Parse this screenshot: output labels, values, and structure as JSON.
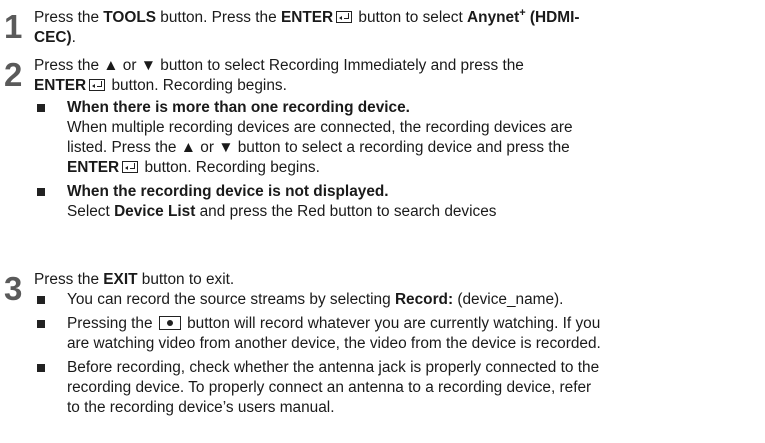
{
  "steps": [
    {
      "number": "1",
      "text": {
        "a": "Press the ",
        "tools": "TOOLS",
        "b": " button. Press the ",
        "enter": "ENTER",
        "c": " button to select ",
        "anynet": "Anynet",
        "plus": "+",
        "hdmi1": " (HDMI-",
        "hdmi2": "CEC)",
        "period": "."
      }
    },
    {
      "number": "2",
      "text": {
        "line1": "Press the ▲ or ▼ button to select Recording Immediately and press the",
        "enter": "ENTER",
        "rest": " button. Recording begins."
      },
      "bullets": [
        {
          "heading": "When there is more than one recording device.",
          "line1": "When multiple recording devices are connected, the recording devices are",
          "line2": "listed. Press the ▲ or ▼ button to select a recording device and press the",
          "enter": "ENTER",
          "rest": " button. Recording begins."
        },
        {
          "heading": "When the recording device is not displayed.",
          "a": "Select ",
          "device_list": "Device List",
          "b": " and press the Red button to search devices"
        }
      ]
    },
    {
      "number": "3",
      "text": {
        "a": "Press the ",
        "exit": "EXIT",
        "b": " button to exit."
      },
      "bullets": [
        {
          "a": "You can record the source streams by selecting ",
          "record": "Record:",
          "b": " (device_name)."
        },
        {
          "a": "Pressing the ",
          "icon": "record-button-icon",
          "line1": " button will record whatever you are currently watching. If you",
          "line2": "are watching video from another device, the video from the device is recorded."
        },
        {
          "line1": "Before recording, check whether the antenna jack is properly connected to the",
          "line2": "recording device. To properly connect an antenna to a recording device, refer",
          "line3": "to the recording device’s users manual."
        }
      ]
    }
  ]
}
